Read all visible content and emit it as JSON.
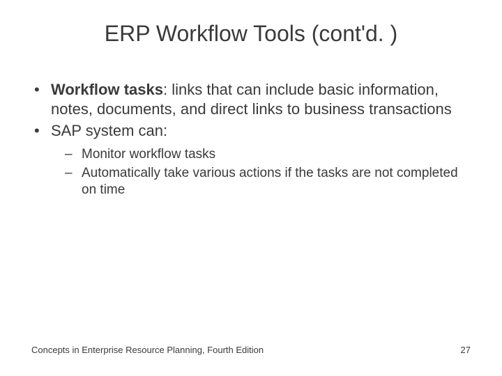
{
  "title": "ERP Workflow Tools (cont'd. )",
  "bullets": {
    "b1": {
      "term": "Workflow tasks",
      "rest": ": links that can include basic information, notes, documents, and direct links to business transactions"
    },
    "b2": {
      "text": "SAP system can:",
      "sub1": "Monitor workflow tasks",
      "sub2": "Automatically take various actions if the tasks are not completed on time"
    }
  },
  "footer": {
    "left": "Concepts in Enterprise Resource Planning, Fourth Edition",
    "right": "27"
  }
}
